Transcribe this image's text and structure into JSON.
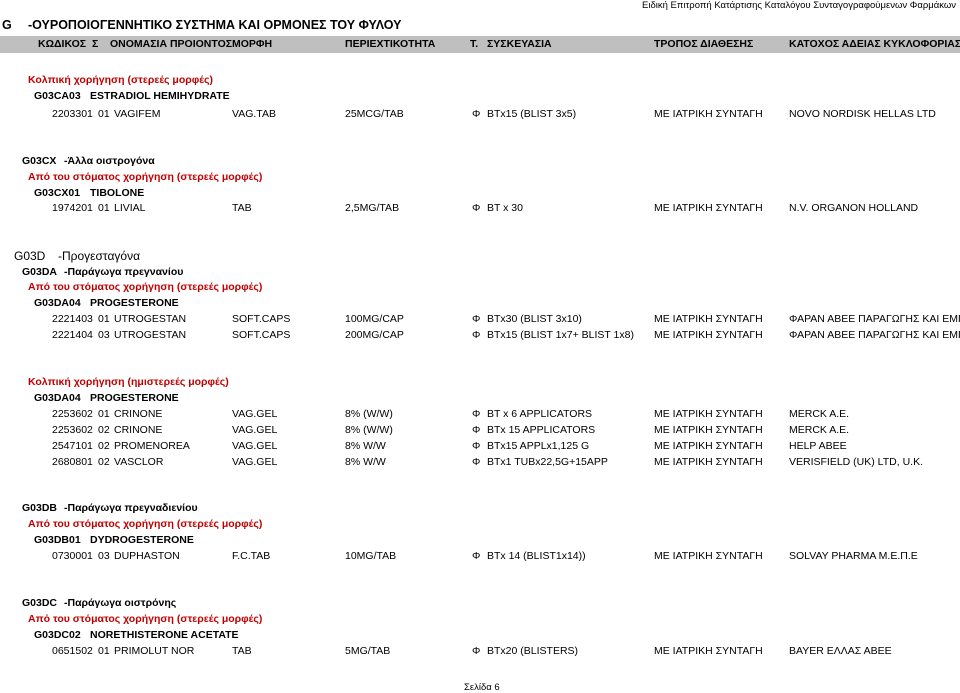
{
  "header": {
    "right_text": "Ειδική Επιτροπή Κατάρτισης Καταλόγου Συνταγογραφούμενων Φαρμάκων",
    "code": "G",
    "title": "-ΟΥΡΟΠΟΙΟΓΕΝΝΗΤΙΚΟ ΣΥΣΤΗΜΑ ΚΑΙ ΟΡΜΟΝΕΣ ΤΟΥ ΦΥΛΟΥ"
  },
  "columns": {
    "code": "ΚΩΔΙΚΟΣ",
    "s": "Σ",
    "name": "ΟΝΟΜΑΣΙΑ ΠΡΟΙΟΝΤΟΣ",
    "form": "ΜΟΡΦΗ",
    "content": "ΠΕΡΙΕΧΤΙΚΟΤΗΤΑ",
    "t": "Τ.",
    "package": "ΣΥΣΚΕΥΑΣΙΑ",
    "dispense": "ΤΡΟΠΟΣ ΔΙΑΘΕΣΗΣ",
    "holder": "ΚΑΤΟΧΟΣ ΑΔΕΙΑΣ ΚΥΚΛΟΦΟΡΙΑΣ"
  },
  "lines": {
    "l1": "Κολπική χορήγηση (στερεές μορφές)",
    "l2_code": "G03CA03",
    "l2_name": "ESTRADIOL HEMIHYDRATE",
    "r1": {
      "code": "2203301",
      "s": "01",
      "name": "VAGIFEM",
      "form": "VAG.TAB",
      "content": "25MCG/TAB",
      "t": "Φ",
      "package": "BTx15 (BLIST 3x5)",
      "dispense": "ΜΕ  ΙΑΤΡΙΚΗ ΣΥΝΤΑΓΗ",
      "holder": "NOVO NORDISK HELLAS LTD"
    },
    "g03cx_code": "G03CX",
    "g03cx_name": "-Άλλα οιστρογόνα",
    "oral1": "Από του στόματος χορήγηση (στερεές μορφές)",
    "g03cx01_code": "G03CX01",
    "g03cx01_name": "TIBOLONE",
    "r2": {
      "code": "1974201",
      "s": "01",
      "name": "LIVIAL",
      "form": "TAB",
      "content": "2,5MG/TAB",
      "t": "Φ",
      "package": "BT x 30",
      "dispense": "ΜΕ  ΙΑΤΡΙΚΗ ΣΥΝΤΑΓΗ",
      "holder": "N.V. ORGANON HOLLAND"
    },
    "g03d_code": "G03D",
    "g03d_name": "-Προγεσταγόνα",
    "g03da_code": "G03DA",
    "g03da_name": "-Παράγωγα πρεγνανίου",
    "oral2": "Από του στόματος χορήγηση (στερεές μορφές)",
    "g03da04_code": "G03DA04",
    "g03da04_name": "PROGESTERONE",
    "r3": {
      "code": "2221403",
      "s": "01",
      "name": "UTROGESTAN",
      "form": "SOFT.CAPS",
      "content": "100MG/CAP",
      "t": "Φ",
      "package": "BTx30 (BLIST 3x10)",
      "dispense": "ΜΕ  ΙΑΤΡΙΚΗ ΣΥΝΤΑΓΗ",
      "holder": "ΦΑΡΑΝ ΑΒΕΕ ΠΑΡΑΓΩΓΗΣ ΚΑΙ ΕΜΠΟΡ"
    },
    "r4": {
      "code": "2221404",
      "s": "03",
      "name": "UTROGESTAN",
      "form": "SOFT.CAPS",
      "content": "200MG/CAP",
      "t": "Φ",
      "package": "BTx15 (BLIST 1x7+ BLIST 1x8)",
      "dispense": "ΜΕ  ΙΑΤΡΙΚΗ ΣΥΝΤΑΓΗ",
      "holder": "ΦΑΡΑΝ ΑΒΕΕ ΠΑΡΑΓΩΓΗΣ ΚΑΙ ΕΜΠΟΡ"
    },
    "vag_semi": "Κολπική χορήγηση (ημιστερεές μορφές)",
    "g03da04b_code": "G03DA04",
    "g03da04b_name": "PROGESTERONE",
    "r5": {
      "code": "2253602",
      "s": "01",
      "name": "CRINONE",
      "form": "VAG.GEL",
      "content": "8% (W/W)",
      "t": "Φ",
      "package": "BT x  6 APPLICATORS",
      "dispense": "ΜΕ  ΙΑΤΡΙΚΗ ΣΥΝΤΑΓΗ",
      "holder": "MERCK A.E."
    },
    "r6": {
      "code": "2253602",
      "s": "02",
      "name": "CRINONE",
      "form": "VAG.GEL",
      "content": "8% (W/W)",
      "t": "Φ",
      "package": "BTx 15 APPLICATORS",
      "dispense": "ΜΕ  ΙΑΤΡΙΚΗ ΣΥΝΤΑΓΗ",
      "holder": "MERCK A.E."
    },
    "r7": {
      "code": "2547101",
      "s": "02",
      "name": "PROMENOREA",
      "form": "VAG.GEL",
      "content": "8% W/W",
      "t": "Φ",
      "package": "BTx15 APPLx1,125 G",
      "dispense": "ΜΕ  ΙΑΤΡΙΚΗ ΣΥΝΤΑΓΗ",
      "holder": "HELP ABEE"
    },
    "r8": {
      "code": "2680801",
      "s": "02",
      "name": "VASCLOR",
      "form": "VAG.GEL",
      "content": "8% W/W",
      "t": "Φ",
      "package": "BTx1 TUBx22,5G+15APP",
      "dispense": "ΜΕ  ΙΑΤΡΙΚΗ ΣΥΝΤΑΓΗ",
      "holder": "VERISFIELD (UK) LTD, U.K."
    },
    "g03db_code": "G03DB",
    "g03db_name": "-Παράγωγα πρεγναδιενίου",
    "oral3": "Από του στόματος χορήγηση (στερεές μορφές)",
    "g03db01_code": "G03DB01",
    "g03db01_name": "DYDROGESTERONE",
    "r9": {
      "code": "0730001",
      "s": "03",
      "name": "DUPHASTON",
      "form": "F.C.TAB",
      "content": "10MG/TAB",
      "t": "Φ",
      "package": "BTx 14 (BLIST1x14))",
      "dispense": "ΜΕ  ΙΑΤΡΙΚΗ ΣΥΝΤΑΓΗ",
      "holder": "SOLVAY PHARMA Μ.Ε.Π.Ε"
    },
    "g03dc_code": "G03DC",
    "g03dc_name": "-Παράγωγα οιστρόνης",
    "oral4": "Από του στόματος χορήγηση (στερεές μορφές)",
    "g03dc02_code": "G03DC02",
    "g03dc02_name": "NORETHISTERONE ACETATE",
    "r10": {
      "code": "0651502",
      "s": "01",
      "name": "PRIMOLUT NOR",
      "form": "TAB",
      "content": "5MG/TAB",
      "t": "Φ",
      "package": "BTx20 (BLISTERS)",
      "dispense": "ΜΕ  ΙΑΤΡΙΚΗ ΣΥΝΤΑΓΗ",
      "holder": "BAYER ΕΛΛΑΣ ΑΒΕΕ"
    }
  },
  "footer": {
    "page": "Σελίδα 6"
  }
}
